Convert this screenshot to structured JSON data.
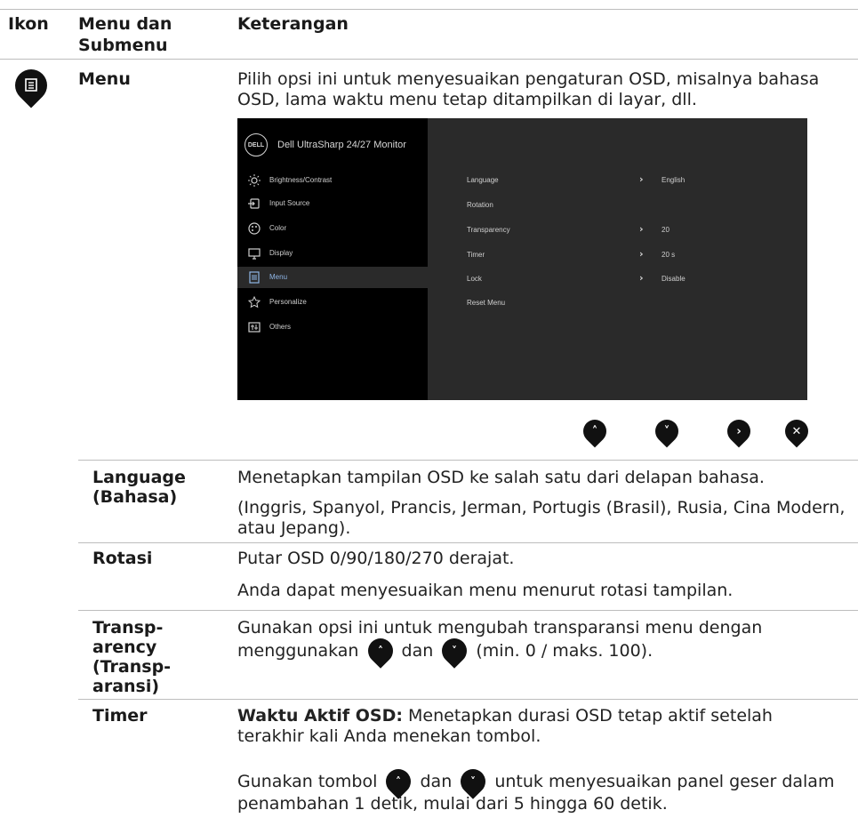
{
  "header": {
    "col_icon": "Ikon",
    "col_menu": "Menu dan Submenu",
    "col_desc": "Keterangan"
  },
  "menu_row": {
    "icon": "menu-list-icon",
    "term": "Menu",
    "desc": "Pilih opsi ini untuk menyesuaikan pengaturan OSD, misalnya bahasa OSD, lama waktu menu tetap ditampilkan di layar, dll."
  },
  "osd": {
    "brand": "DELL",
    "title": "Dell UltraSharp 24/27 Monitor",
    "nav": [
      {
        "label": "Brightness/Contrast",
        "icon": "sun-icon"
      },
      {
        "label": "Input Source",
        "icon": "input-source-icon"
      },
      {
        "label": "Color",
        "icon": "palette-icon"
      },
      {
        "label": "Display",
        "icon": "display-icon"
      },
      {
        "label": "Menu",
        "icon": "menu-list-icon"
      },
      {
        "label": "Personalize",
        "icon": "star-icon"
      },
      {
        "label": "Others",
        "icon": "others-icon"
      }
    ],
    "rows": [
      {
        "label": "Language",
        "value": "English"
      },
      {
        "label": "Rotation",
        "value": ""
      },
      {
        "label": "Transparency",
        "value": "20"
      },
      {
        "label": "Timer",
        "value": "20 s"
      },
      {
        "label": "Lock",
        "value": "Disable"
      },
      {
        "label": "Reset Menu",
        "value": ""
      }
    ],
    "controls": [
      "up-icon",
      "down-icon",
      "right-icon",
      "close-icon"
    ]
  },
  "sub": {
    "language": {
      "term": "Language (Bahasa)",
      "desc1": "Menetapkan tampilan OSD ke salah satu dari delapan bahasa.",
      "desc2": "(Inggris, Spanyol, Prancis, Jerman, Portugis (Brasil), Rusia, Cina Modern, atau Jepang)."
    },
    "rotasi": {
      "term": "Rotasi",
      "desc1": "Putar OSD 0/90/180/270 derajat.",
      "desc2": "Anda dapat menyesuaikan menu menurut rotasi tampilan."
    },
    "transparency": {
      "term": "Transp- arency (Transp- aransi)",
      "desc_a": "Gunakan opsi ini untuk mengubah transparansi menu dengan menggunakan",
      "desc_b": "dan",
      "desc_c": "(min. 0 / maks. 100)."
    },
    "timer": {
      "term": "Timer",
      "bold": "Waktu Aktif OSD:",
      "desc1": "Menetapkan durasi OSD tetap aktif setelah terakhir kali Anda menekan tombol.",
      "desc2_a": "Gunakan tombol",
      "desc2_b": "dan",
      "desc2_c": "untuk menyesuaikan panel geser dalam penambahan 1 detik, mulai dari 5 hingga 60 detik."
    }
  }
}
